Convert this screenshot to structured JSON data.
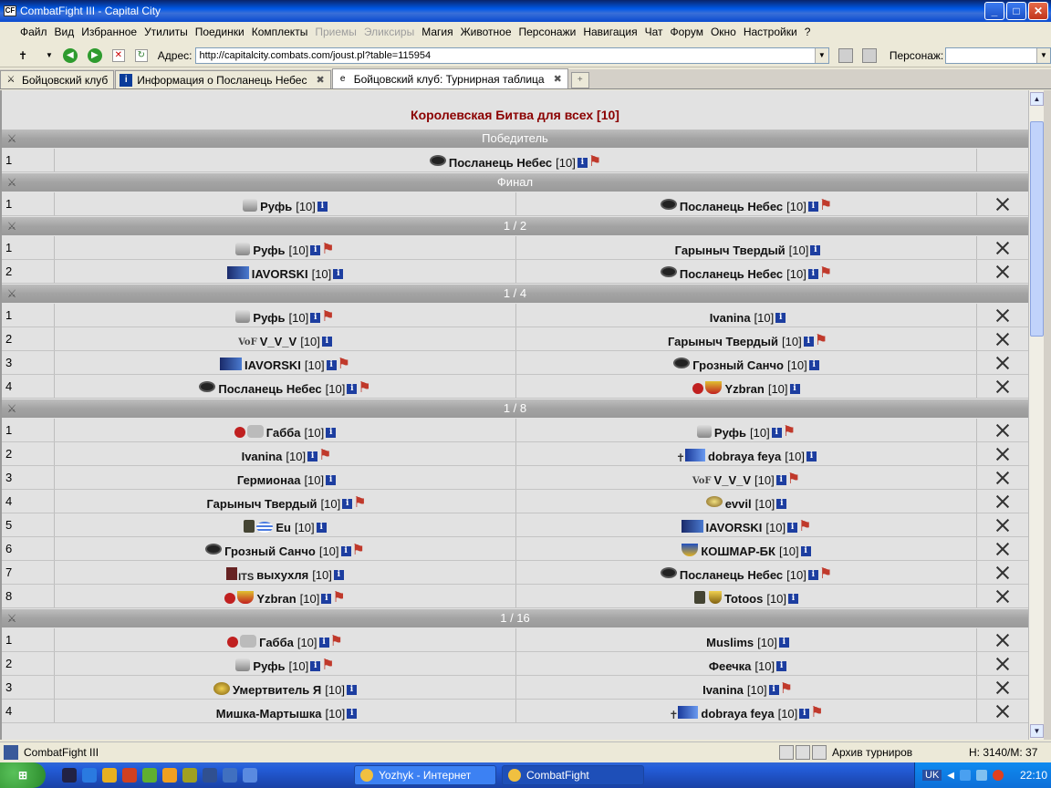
{
  "window": {
    "title": "CombatFight III - Capital City",
    "minimize": "_",
    "maximize": "□",
    "close": "✕"
  },
  "menu": [
    {
      "label": "Файл",
      "disabled": false
    },
    {
      "label": "Вид",
      "disabled": false
    },
    {
      "label": "Избранное",
      "disabled": false
    },
    {
      "label": "Утилиты",
      "disabled": false
    },
    {
      "label": "Поединки",
      "disabled": false
    },
    {
      "label": "Комплекты",
      "disabled": false
    },
    {
      "label": "Приемы",
      "disabled": true
    },
    {
      "label": "Эликсиры",
      "disabled": true
    },
    {
      "label": "Магия",
      "disabled": false
    },
    {
      "label": "Животное",
      "disabled": false
    },
    {
      "label": "Персонажи",
      "disabled": false
    },
    {
      "label": "Навигация",
      "disabled": false
    },
    {
      "label": "Чат",
      "disabled": false
    },
    {
      "label": "Форум",
      "disabled": false
    },
    {
      "label": "Окно",
      "disabled": false
    },
    {
      "label": "Настройки",
      "disabled": false
    },
    {
      "label": "?",
      "disabled": false
    }
  ],
  "toolbar": {
    "address_label": "Адрес:",
    "address_value": "http://capitalcity.combats.com/joust.pl?table=115954",
    "person_label": "Персонаж:",
    "person_value": ""
  },
  "tabs": [
    {
      "label": "Бойцовский клуб",
      "icon": "swords-icon",
      "active": false
    },
    {
      "label": "Информация о Посланець Небес",
      "icon": "info-icon",
      "active": false
    },
    {
      "label": "Бойцовский клуб: Турнирная таблица",
      "icon": "ie-icon",
      "active": true
    }
  ],
  "page": {
    "heading": "Королевская Битва для всех [10]"
  },
  "sections": [
    {
      "title": "Победитель",
      "winner": true,
      "rows": [
        {
          "num": "1",
          "left": {
            "name": "Посланець Небес",
            "level": "[10]",
            "clan": "mask",
            "flag": true
          }
        }
      ]
    },
    {
      "title": "Финал",
      "rows": [
        {
          "num": "1",
          "left": {
            "name": "Руфь",
            "level": "[10]",
            "clan": "wolf",
            "flag": false
          },
          "right": {
            "name": "Посланець Небес",
            "level": "[10]",
            "clan": "mask",
            "flag": true
          }
        }
      ]
    },
    {
      "title": "1 / 2",
      "rows": [
        {
          "num": "1",
          "left": {
            "name": "Руфь",
            "level": "[10]",
            "clan": "wolf",
            "flag": true
          },
          "right": {
            "name": "Гарыныч Твердый",
            "level": "[10]",
            "clan": "",
            "flag": false
          }
        },
        {
          "num": "2",
          "left": {
            "name": "IAVORSKI",
            "level": "[10]",
            "clan": "blue-banner",
            "flag": false
          },
          "right": {
            "name": "Посланець Небес",
            "level": "[10]",
            "clan": "mask",
            "flag": true
          }
        }
      ]
    },
    {
      "title": "1 / 4",
      "rows": [
        {
          "num": "1",
          "left": {
            "name": "Руфь",
            "level": "[10]",
            "clan": "wolf",
            "flag": true
          },
          "right": {
            "name": "Ivanina",
            "level": "[10]",
            "clan": "",
            "flag": false
          }
        },
        {
          "num": "2",
          "left": {
            "name": "V_V_V",
            "level": "[10]",
            "clan": "vof",
            "flag": false
          },
          "right": {
            "name": "Гарыныч Твердый",
            "level": "[10]",
            "clan": "",
            "flag": true
          }
        },
        {
          "num": "3",
          "left": {
            "name": "IAVORSKI",
            "level": "[10]",
            "clan": "blue-banner",
            "flag": true
          },
          "right": {
            "name": "Грозный Санчо",
            "level": "[10]",
            "clan": "mask",
            "flag": false
          }
        },
        {
          "num": "4",
          "left": {
            "name": "Посланець Небес",
            "level": "[10]",
            "clan": "mask",
            "flag": true
          },
          "right": {
            "name": "Yzbran",
            "level": "[10]",
            "clan": "cross-shield",
            "flag": false
          }
        }
      ]
    },
    {
      "title": "1 / 8",
      "rows": [
        {
          "num": "1",
          "left": {
            "name": "Габба",
            "level": "[10]",
            "clan": "cross-skull",
            "flag": false
          },
          "right": {
            "name": "Руфь",
            "level": "[10]",
            "clan": "wolf",
            "flag": true
          }
        },
        {
          "num": "2",
          "left": {
            "name": "Ivanina",
            "level": "[10]",
            "clan": "",
            "flag": true
          },
          "right": {
            "name": "dobraya feya",
            "level": "[10]",
            "clan": "cross-blue",
            "flag": false
          }
        },
        {
          "num": "3",
          "left": {
            "name": "Гермионаа",
            "level": "[10]",
            "clan": "",
            "flag": false
          },
          "right": {
            "name": "V_V_V",
            "level": "[10]",
            "clan": "vof",
            "flag": true
          }
        },
        {
          "num": "4",
          "left": {
            "name": "Гарыныч Твердый",
            "level": "[10]",
            "clan": "",
            "flag": true
          },
          "right": {
            "name": "evvil",
            "level": "[10]",
            "clan": "coin",
            "flag": false
          }
        },
        {
          "num": "5",
          "left": {
            "name": "Eu",
            "level": "[10]",
            "clan": "dark-wave",
            "flag": false
          },
          "right": {
            "name": "IAVORSKI",
            "level": "[10]",
            "clan": "blue-banner",
            "flag": true
          }
        },
        {
          "num": "6",
          "left": {
            "name": "Грозный Санчо",
            "level": "[10]",
            "clan": "mask",
            "flag": true
          },
          "right": {
            "name": "КОШМАР-БК",
            "level": "[10]",
            "clan": "shield",
            "flag": false
          }
        },
        {
          "num": "7",
          "left": {
            "name": "выхухля",
            "level": "[10]",
            "clan": "its",
            "flag": false
          },
          "right": {
            "name": "Посланець Небес",
            "level": "[10]",
            "clan": "mask",
            "flag": true
          }
        },
        {
          "num": "8",
          "left": {
            "name": "Yzbran",
            "level": "[10]",
            "clan": "cross-shield",
            "flag": true
          },
          "right": {
            "name": "Totoos",
            "level": "[10]",
            "clan": "dark-gold",
            "flag": false
          }
        }
      ]
    },
    {
      "title": "1 / 16",
      "rows": [
        {
          "num": "1",
          "left": {
            "name": "Габба",
            "level": "[10]",
            "clan": "cross-skull",
            "flag": true
          },
          "right": {
            "name": "Muslims",
            "level": "[10]",
            "clan": "",
            "flag": false
          }
        },
        {
          "num": "2",
          "left": {
            "name": "Руфь",
            "level": "[10]",
            "clan": "wolf",
            "flag": true
          },
          "right": {
            "name": "Феечка",
            "level": "[10]",
            "clan": "",
            "flag": false
          }
        },
        {
          "num": "3",
          "left": {
            "name": "Умертвитель Я",
            "level": "[10]",
            "clan": "gold-emblem",
            "flag": false
          },
          "right": {
            "name": "Ivanina",
            "level": "[10]",
            "clan": "",
            "flag": true
          }
        },
        {
          "num": "4",
          "left": {
            "name": "Мишка-Мартышка",
            "level": "[10]",
            "clan": "",
            "flag": false
          },
          "right": {
            "name": "dobraya feya",
            "level": "[10]",
            "clan": "cross-blue",
            "flag": true
          }
        }
      ]
    }
  ],
  "statusbar": {
    "title": "CombatFight III",
    "archive": "Архив турниров",
    "coords": "H: 3140/M: 37"
  },
  "taskbar": {
    "tasks": [
      {
        "label": "Yozhyk - Интернет",
        "active": false
      },
      {
        "label": "CombatFight",
        "active": true
      }
    ],
    "lang": "UK",
    "clock": "22:10"
  },
  "colors": {
    "heading": "#8b0000",
    "section_bar": "#a3a3a3",
    "flag": "#c0392b",
    "info_badge": "#1d3ea0"
  }
}
